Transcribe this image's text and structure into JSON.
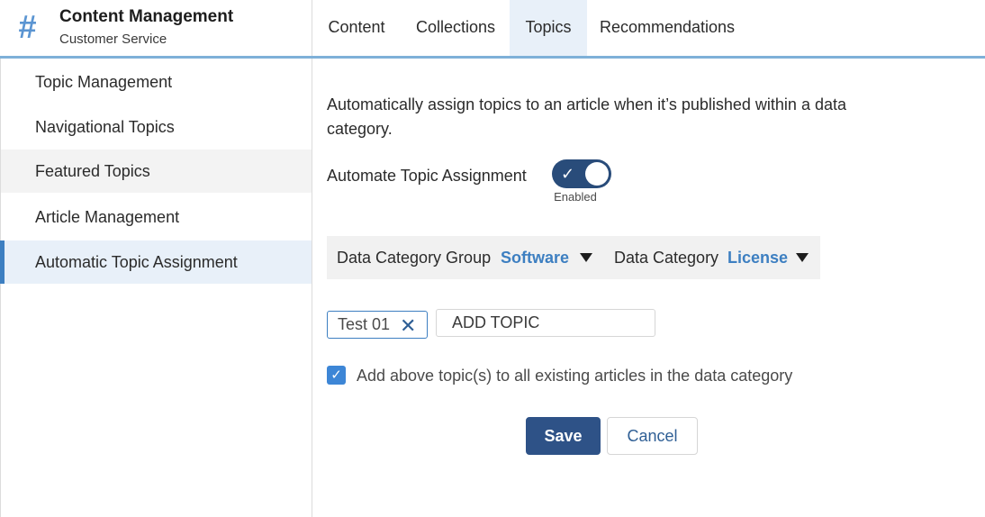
{
  "app": {
    "icon": "hash-icon",
    "icon_glyph": "#",
    "title": "Content Management",
    "subtitle": "Customer Service"
  },
  "tabs": [
    {
      "label": "Content",
      "active": false
    },
    {
      "label": "Collections",
      "active": false
    },
    {
      "label": "Topics",
      "active": true
    },
    {
      "label": "Recommendations",
      "active": false
    }
  ],
  "sidebar": {
    "items": [
      {
        "label": "Topic Management",
        "state": "normal"
      },
      {
        "label": "Navigational Topics",
        "state": "normal"
      },
      {
        "label": "Featured Topics",
        "state": "hover"
      },
      {
        "label": "Article Management",
        "state": "normal"
      },
      {
        "label": "Automatic Topic Assignment",
        "state": "active"
      }
    ]
  },
  "main": {
    "description": "Automatically assign topics to an article when it’s published within a data category.",
    "automate": {
      "label": "Automate Topic Assignment",
      "enabled": true,
      "state_label": "Enabled",
      "check_glyph": "✓"
    },
    "filters": {
      "group_label": "Data Category Group",
      "group_value": "Software",
      "category_label": "Data Category",
      "category_value": "License"
    },
    "topics": {
      "pills": [
        {
          "label": "Test 01",
          "remove_glyph": "✕"
        }
      ],
      "input_placeholder": "ADD TOPIC"
    },
    "apply_existing": {
      "checked": true,
      "check_glyph": "✓",
      "label": "Add above topic(s) to all existing articles in the data category"
    },
    "buttons": {
      "save": "Save",
      "cancel": "Cancel"
    }
  },
  "colors": {
    "accent": "#3d7fc1",
    "primary_button": "#2e5287",
    "toggle_on": "#294c7a",
    "active_bg": "#e8f0f9",
    "header_line": "#7eb0d8"
  }
}
